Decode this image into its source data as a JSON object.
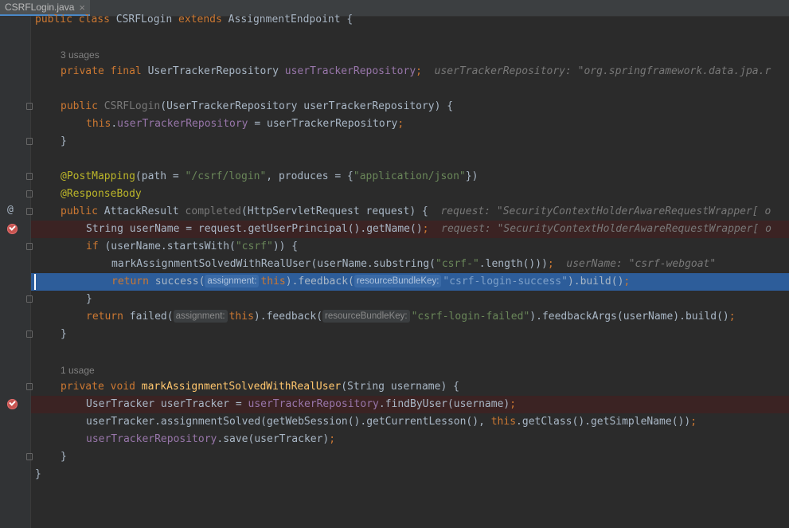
{
  "tab": {
    "filename": "CSRFLogin.java",
    "close": "×"
  },
  "code": {
    "class_decl": [
      "public ",
      "class ",
      "CSRFLogin ",
      "extends ",
      "AssignmentEndpoint {"
    ],
    "usages_3": "3 usages",
    "field_line": [
      "private ",
      "final ",
      "UserTrackerRepository ",
      "userTrackerRepository",
      ";"
    ],
    "field_hint": "userTrackerRepository: \"org.springframework.data.jpa.r",
    "ctor_line": [
      "public ",
      "CSRFLogin",
      "(UserTrackerRepository userTrackerRepository) {"
    ],
    "ctor_body": [
      "this",
      ".",
      "userTrackerRepository",
      " = userTrackerRepository",
      ";"
    ],
    "close_brace": "}",
    "postmapping": [
      "@PostMapping",
      "(path = ",
      "\"/csrf/login\"",
      ", produces = {",
      "\"application/json\"",
      "})"
    ],
    "responsebody": "@ResponseBody",
    "method_line": [
      "public ",
      "AttackResult ",
      "completed",
      "(HttpServletRequest request) {"
    ],
    "method_hint": "request: \"SecurityContextHolderAwareRequestWrapper[ o",
    "username_line": [
      "String userName = request.getUserPrincipal().getName()",
      ";"
    ],
    "username_hint": "request: \"SecurityContextHolderAwareRequestWrapper[ o",
    "if_line": [
      "if ",
      "(userName.startsWith(",
      "\"csrf\"",
      ")) {"
    ],
    "mark_line": [
      "markAssignmentSolvedWithRealUser(userName.substring(",
      "\"csrf-\"",
      ".length()))",
      ";"
    ],
    "mark_hint": "userName: \"csrf-webgoat\"",
    "return_success": [
      "return ",
      "success(",
      "this",
      ").feedback(",
      "\"csrf-login-success\"",
      ").build()",
      ";"
    ],
    "pill_assignment": "assignment:",
    "pill_resource_key": "resourceBundleKey:",
    "return_failed": [
      "return ",
      "failed(",
      "this",
      ").feedback(",
      "\"csrf-login-failed\"",
      ").feedbackArgs(userName).build()",
      ";"
    ],
    "usages_1": "1 usage",
    "private_method": [
      "private ",
      "void ",
      "markAssignmentSolvedWithRealUser",
      "(String username) {"
    ],
    "tracker_line": [
      "UserTracker userTracker = ",
      "userTrackerRepository",
      ".findByUser(username)",
      ";"
    ],
    "solved_line": [
      "userTracker.assignmentSolved(getWebSession().getCurrentLesson(), ",
      "this",
      ".getClass().getSimpleName())",
      ";"
    ],
    "save_line": [
      "userTrackerRepository",
      ".save(userTracker)",
      ";"
    ]
  },
  "gutter": {
    "at_icon": "@"
  }
}
